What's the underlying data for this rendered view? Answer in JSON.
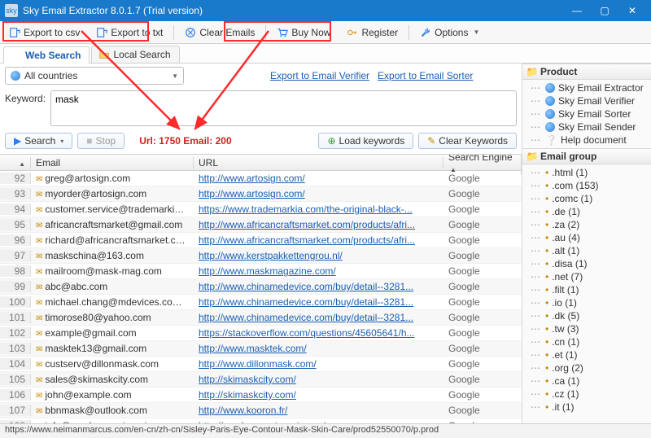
{
  "window": {
    "title": "Sky Email Extractor 8.0.1.7 (Trial version)"
  },
  "toolbar": {
    "export_csv": "Export to csv",
    "export_txt": "Export to txt",
    "clear_emails": "Clear Emails",
    "buy_now": "Buy Now",
    "register": "Register",
    "options": "Options"
  },
  "tabs": {
    "web_search": "Web Search",
    "local_search": "Local Search"
  },
  "country": {
    "label": "All countries"
  },
  "export_links": {
    "verifier": "Export to Email Verifier",
    "sorter": "Export to Email Sorter"
  },
  "keyword": {
    "label": "Keyword:",
    "value": "mask"
  },
  "actions": {
    "search": "Search",
    "stop": "Stop",
    "load_keywords": "Load keywords",
    "clear_keywords": "Clear Keywords"
  },
  "counter": "Url: 1750 Email: 200",
  "grid": {
    "headers": {
      "n": "",
      "email": "Email",
      "url": "URL",
      "engine": "Search Engine"
    },
    "rows": [
      {
        "n": 92,
        "email": "greg@artosign.com",
        "url": "http://www.artosign.com/",
        "engine": "Google"
      },
      {
        "n": 93,
        "email": "myorder@artosign.com",
        "url": "http://www.artosign.com/",
        "engine": "Google"
      },
      {
        "n": 94,
        "email": "customer.service@trademarkia.c...",
        "url": "https://www.trademarkia.com/the-original-black-...",
        "engine": "Google"
      },
      {
        "n": 95,
        "email": "africancraftsmarket@gmail.com",
        "url": "http://www.africancraftsmarket.com/products/afri...",
        "engine": "Google"
      },
      {
        "n": 96,
        "email": "richard@africancraftsmarket.com",
        "url": "http://www.africancraftsmarket.com/products/afri...",
        "engine": "Google"
      },
      {
        "n": 97,
        "email": "maskschina@163.com",
        "url": "http://www.kerstpakkettengrou.nl/",
        "engine": "Google"
      },
      {
        "n": 98,
        "email": "mailroom@mask-mag.com",
        "url": "http://www.maskmagazine.com/",
        "engine": "Google"
      },
      {
        "n": 99,
        "email": "abc@abc.com",
        "url": "http://www.chinamedevice.com/buy/detail--3281...",
        "engine": "Google"
      },
      {
        "n": 100,
        "email": "michael.chang@mdevices.com.au",
        "url": "http://www.chinamedevice.com/buy/detail--3281...",
        "engine": "Google"
      },
      {
        "n": 101,
        "email": "timorose80@yahoo.com",
        "url": "http://www.chinamedevice.com/buy/detail--3281...",
        "engine": "Google"
      },
      {
        "n": 102,
        "email": "example@gmail.com",
        "url": "https://stackoverflow.com/questions/45605641/h...",
        "engine": "Google"
      },
      {
        "n": 103,
        "email": "masktek13@gmail.com",
        "url": "http://www.masktek.com/",
        "engine": "Google"
      },
      {
        "n": 104,
        "email": "custserv@dillonmask.com",
        "url": "http://www.dillonmask.com/",
        "engine": "Google"
      },
      {
        "n": 105,
        "email": "sales@skimaskcity.com",
        "url": "http://skimaskcity.com/",
        "engine": "Google"
      },
      {
        "n": 106,
        "email": "john@example.com",
        "url": "http://skimaskcity.com/",
        "engine": "Google"
      },
      {
        "n": 107,
        "email": "bbnmask@outlook.com",
        "url": "http://www.kooron.fr/",
        "engine": "Google"
      },
      {
        "n": 108,
        "email": "info@maskwaengineering.ca",
        "url": "http://maskwaengineering.ca/",
        "engine": "Google"
      }
    ]
  },
  "product": {
    "header": "Product",
    "items": [
      "Sky Email Extractor",
      "Sky Email Verifier",
      "Sky Email Sorter",
      "Sky Email Sender",
      "Help document"
    ]
  },
  "email_group": {
    "header": "Email group",
    "items": [
      ".html (1)",
      ".com (153)",
      ".comc (1)",
      ".de (1)",
      ".za (2)",
      ".au (4)",
      ".alt (1)",
      ".disa (1)",
      ".net (7)",
      ".filt (1)",
      ".io (1)",
      ".dk (5)",
      ".tw (3)",
      ".cn (1)",
      ".et (1)",
      ".org (2)",
      ".ca (1)",
      ".cz (1)",
      ".it (1)"
    ]
  },
  "statusbar": "https://www.neimanmarcus.com/en-cn/zh-cn/Sisley-Paris-Eye-Contour-Mask-Skin-Care/prod52550070/p.prod"
}
